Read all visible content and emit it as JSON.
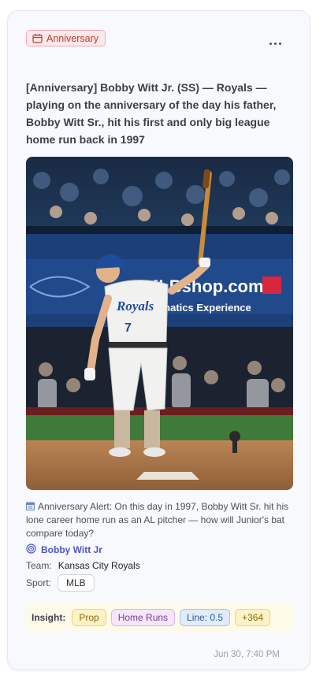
{
  "tag": {
    "label": "Anniversary",
    "icon": "calendar-icon",
    "color": "#c0392b"
  },
  "headline": "[Anniversary] Bobby Witt Jr. (SS) — Royals — playing on the anniversary of the day his father, Bobby Witt Sr., hit his first and only big league home run back in 1997",
  "photo": {
    "description": "Kansas City Royals batter in white uniform number 7 holding bat up after hitting, crowd in background",
    "jersey_text": "Royals",
    "jersey_number": "7",
    "ad_text": "MLBshop.com",
    "ad_subtext": "Fanatics Experience"
  },
  "alert": {
    "icon": "calendar-icon",
    "text": "Anniversary Alert: On this day in 1997, Bobby Witt Sr. hit his lone career home run as an AL pitcher — how will Junior's bat compare today?"
  },
  "player": {
    "name": "Bobby Witt Jr",
    "icon": "target-icon"
  },
  "team": {
    "label": "Team:",
    "value": "Kansas City Royals"
  },
  "sport": {
    "label": "Sport:",
    "value": "MLB"
  },
  "insight": {
    "label": "Insight:",
    "chips": [
      "Prop",
      "Home Runs",
      "Line: 0.5",
      "+364"
    ]
  },
  "timestamp": "Jun 30, 7:40 PM"
}
